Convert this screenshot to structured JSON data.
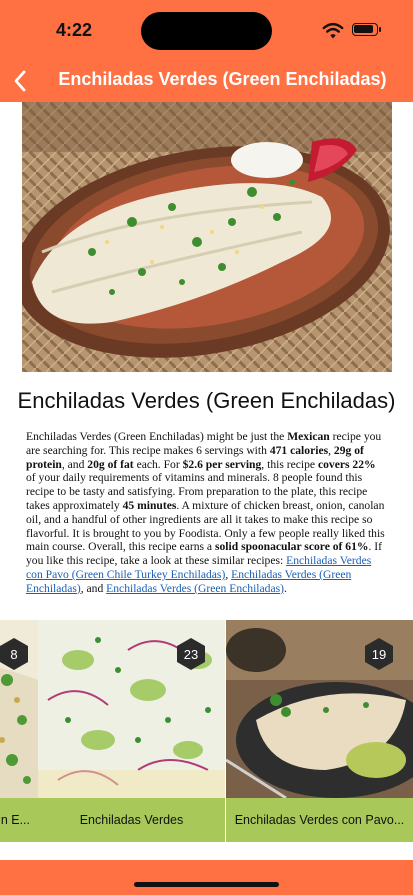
{
  "status": {
    "time": "4:22"
  },
  "nav": {
    "title": "Enchiladas Verdes (Green Enchiladas)"
  },
  "recipe": {
    "title": "Enchiladas Verdes (Green Enchiladas)",
    "summary": [
      {
        "t": "Enchiladas Verdes (Green Enchiladas) might be just the "
      },
      {
        "t": "Mexican",
        "b": true
      },
      {
        "t": " recipe you are searching for. This recipe makes 6 servings with "
      },
      {
        "t": "471 calories",
        "b": true
      },
      {
        "t": ", "
      },
      {
        "t": "29g of protein",
        "b": true
      },
      {
        "t": ", and "
      },
      {
        "t": "20g of fat",
        "b": true
      },
      {
        "t": " each. For "
      },
      {
        "t": "$2.6 per serving",
        "b": true
      },
      {
        "t": ", this recipe "
      },
      {
        "t": "covers 22%",
        "b": true
      },
      {
        "t": " of your daily requirements of vitamins and minerals. 8 people found this recipe to be tasty and satisfying. From preparation to the plate, this recipe takes approximately "
      },
      {
        "t": "45 minutes",
        "b": true
      },
      {
        "t": ". A mixture of chicken breast, onion, canolan oil, and a handful of other ingredients are all it takes to make this recipe so flavorful. It is brought to you by Foodista. Only a few people really liked this main course. Overall, this recipe earns a "
      },
      {
        "t": "solid spoonacular score of 61%",
        "b": true
      },
      {
        "t": ". If you like this recipe, take a look at these similar recipes: "
      },
      {
        "t": "Enchiladas Verdes con Pavo (Green Chile Turkey Enchiladas)",
        "link": true
      },
      {
        "t": ", "
      },
      {
        "t": "Enchiladas Verdes (Green Enchiladas)",
        "link": true
      },
      {
        "t": ", and "
      },
      {
        "t": "Enchiladas Verdes (Green Enchiladas)",
        "link": true
      },
      {
        "t": "."
      }
    ]
  },
  "similar": [
    {
      "caption": "n E...",
      "badge": "8"
    },
    {
      "caption": "Enchiladas Verdes",
      "badge": "23"
    },
    {
      "caption": "Enchiladas Verdes con Pavo...",
      "badge": "19"
    }
  ],
  "colors": {
    "primary": "#FF7043",
    "caption_bg": "#A8C95A",
    "link": "#1a5fb4"
  },
  "icons": {
    "back": "chevron-left-icon",
    "wifi": "wifi-icon",
    "battery": "battery-icon",
    "badge": "hexagon-badge"
  }
}
